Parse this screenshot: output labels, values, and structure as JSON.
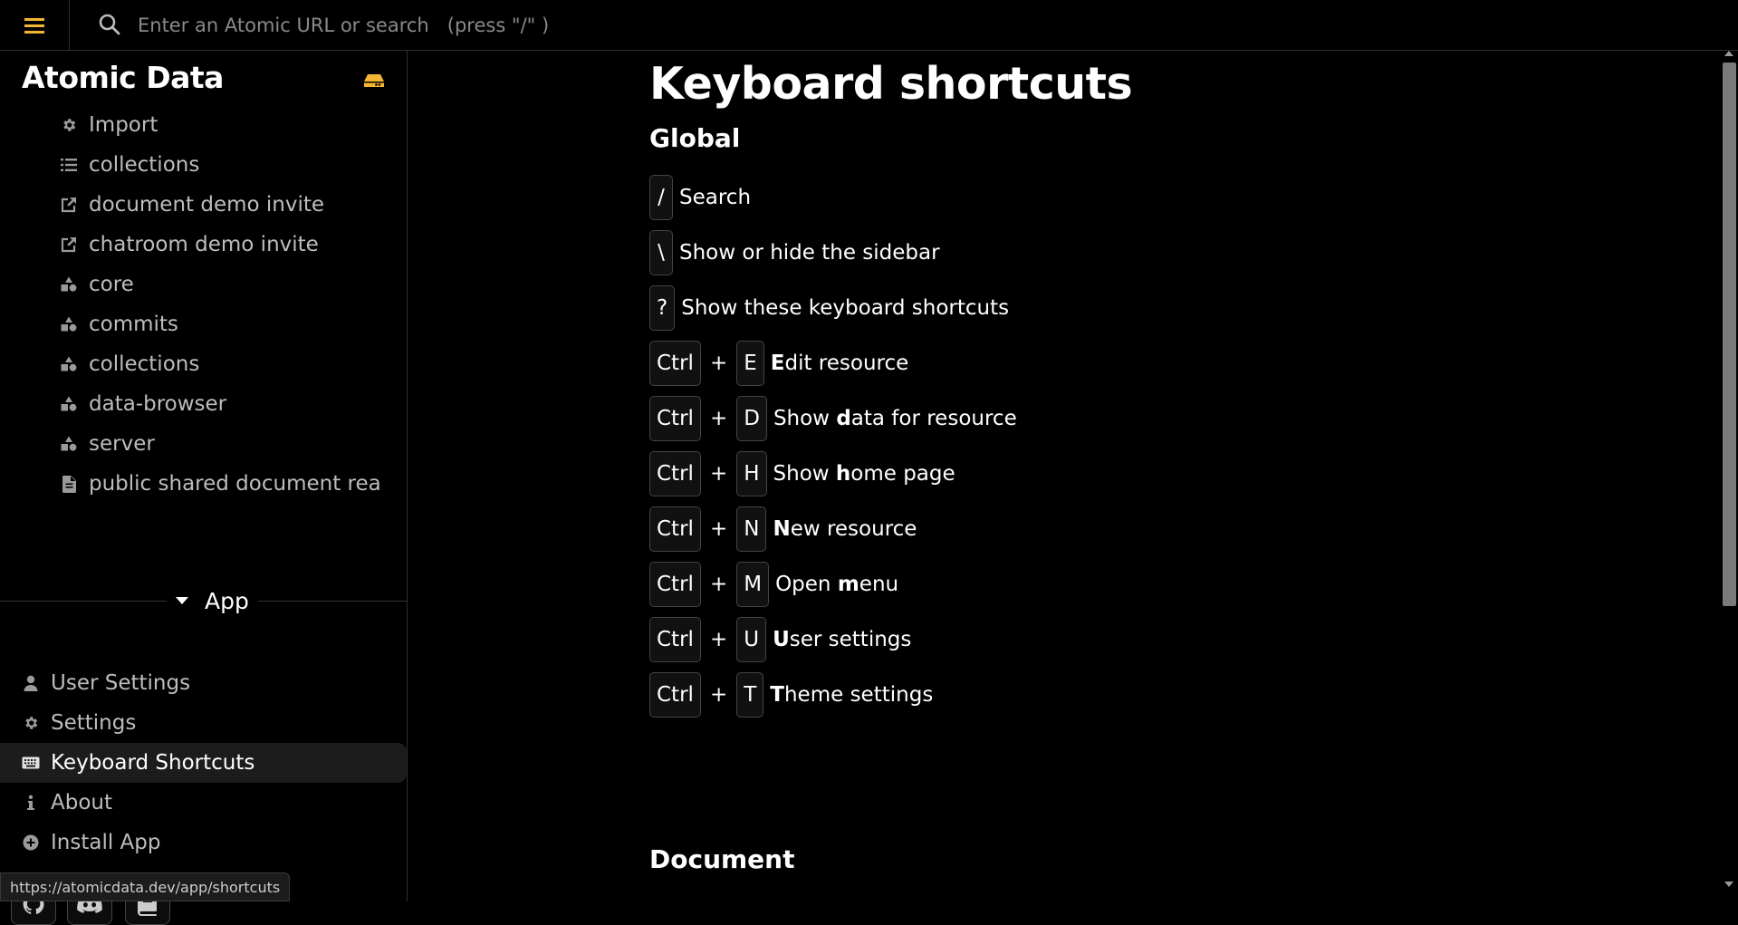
{
  "search": {
    "placeholder": "Enter an Atomic URL or search   (press \"/\" )"
  },
  "sidebar": {
    "brand": "Atomic Data",
    "resources": [
      {
        "label": "Import",
        "icon": "gear-icon"
      },
      {
        "label": "collections",
        "icon": "list-icon"
      },
      {
        "label": "document demo invite",
        "icon": "share-icon"
      },
      {
        "label": "chatroom demo invite",
        "icon": "share-icon"
      },
      {
        "label": "core",
        "icon": "shapes-icon"
      },
      {
        "label": "commits",
        "icon": "shapes-icon"
      },
      {
        "label": "collections",
        "icon": "shapes-icon"
      },
      {
        "label": "data-browser",
        "icon": "shapes-icon"
      },
      {
        "label": "server",
        "icon": "shapes-icon"
      },
      {
        "label": "public shared document rea",
        "icon": "document-icon"
      }
    ],
    "app_heading": "App",
    "app_items": [
      {
        "label": "User Settings",
        "icon": "user-icon"
      },
      {
        "label": "Settings",
        "icon": "gear-icon"
      },
      {
        "label": "Keyboard Shortcuts",
        "icon": "keyboard-icon",
        "active": true
      },
      {
        "label": "About",
        "icon": "info-icon"
      },
      {
        "label": "Install App",
        "icon": "plus-circle-icon"
      }
    ],
    "social": [
      "github-icon",
      "discord-icon",
      "book-icon"
    ]
  },
  "status_url": "https://atomicdata.dev/app/shortcuts",
  "main": {
    "title": "Keyboard shortcuts",
    "section_global": "Global",
    "section_document": "Document",
    "shortcuts": [
      {
        "keys": [
          "/"
        ],
        "desc_bold": "",
        "desc_rest": "Search",
        "desc_pre": ""
      },
      {
        "keys": [
          "\\"
        ],
        "desc_bold": "",
        "desc_rest": "Show or hide the sidebar",
        "desc_pre": ""
      },
      {
        "keys": [
          "?"
        ],
        "desc_bold": "",
        "desc_rest": "Show these keyboard shortcuts",
        "desc_pre": ""
      },
      {
        "keys": [
          "Ctrl",
          "E"
        ],
        "desc_pre": "",
        "desc_bold": "E",
        "desc_rest": "dit resource"
      },
      {
        "keys": [
          "Ctrl",
          "D"
        ],
        "desc_pre": "Show ",
        "desc_bold": "d",
        "desc_rest": "ata for resource"
      },
      {
        "keys": [
          "Ctrl",
          "H"
        ],
        "desc_pre": "Show ",
        "desc_bold": "h",
        "desc_rest": "ome page"
      },
      {
        "keys": [
          "Ctrl",
          "N"
        ],
        "desc_pre": "",
        "desc_bold": "N",
        "desc_rest": "ew resource"
      },
      {
        "keys": [
          "Ctrl",
          "M"
        ],
        "desc_pre": "Open ",
        "desc_bold": "m",
        "desc_rest": "enu"
      },
      {
        "keys": [
          "Ctrl",
          "U"
        ],
        "desc_pre": "",
        "desc_bold": "U",
        "desc_rest": "ser settings"
      },
      {
        "keys": [
          "Ctrl",
          "T"
        ],
        "desc_pre": "",
        "desc_bold": "T",
        "desc_rest": "heme settings"
      }
    ],
    "plus_sign": "+"
  },
  "colors": {
    "background": "#000000",
    "text": "#ffffff",
    "muted": "#bdbdbd",
    "accent": "#f2b632",
    "active_bg": "#1c1c1c"
  }
}
